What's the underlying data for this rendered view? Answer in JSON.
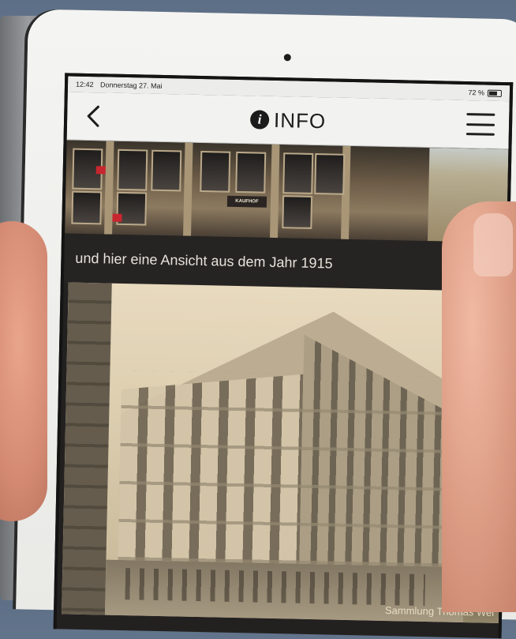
{
  "status_bar": {
    "time": "12:42",
    "date": "Donnerstag 27. Mai",
    "battery": "72 %"
  },
  "nav": {
    "title": "INFO",
    "info_icon_glyph": "i",
    "back_icon": "chevron-left-icon",
    "menu_icon": "hamburger-menu-icon"
  },
  "content": {
    "store_sign": "KAUFHOF",
    "caption": "und hier eine Ansicht aus dem Jahr 1915",
    "photo_credit": "Sammlung Thomas Wei"
  },
  "colors": {
    "nav_background": "#f2f2f0",
    "content_background": "#262422",
    "caption_text": "#e6e2dc"
  }
}
